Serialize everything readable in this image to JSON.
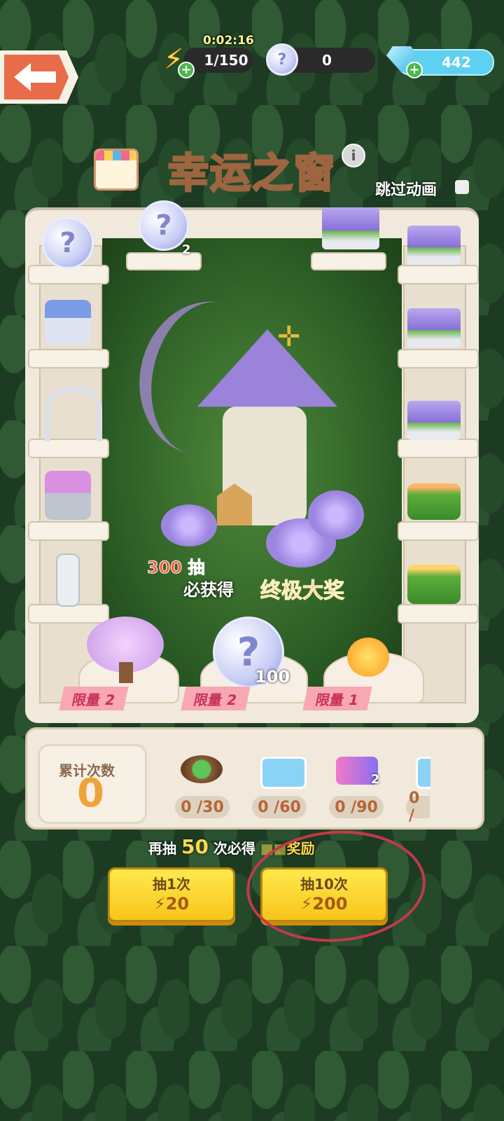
{
  "hud": {
    "timer": "0:02:16",
    "energy": "1/150",
    "coins": "0",
    "gems": "442"
  },
  "title": "幸运之窗",
  "skip_animation_label": "跳过动画",
  "prize_shelf": {
    "top_coin_count": "2",
    "pedestal_coin_count": "100",
    "limits": [
      "限量 2",
      "限量 2",
      "限量 1"
    ]
  },
  "promo": {
    "count": "300",
    "draw_unit": "抽",
    "guarantee_text": "必获得",
    "grand_prize": "终极大奖"
  },
  "progress": {
    "label": "累计次数",
    "value": "0",
    "milestones": [
      {
        "text": "0 /30"
      },
      {
        "text": "0 /60"
      },
      {
        "text": "0 /90",
        "badge": "2"
      },
      {
        "text": "0 /"
      }
    ]
  },
  "hint": {
    "prefix": "再抽",
    "number": "50",
    "middle": "次必得",
    "suffix": "奖励"
  },
  "buttons": {
    "draw_one_label": "抽1次",
    "draw_one_cost": "20",
    "draw_ten_label": "抽10次",
    "draw_ten_cost": "200"
  },
  "colors": {
    "accent_yellow": "#f8c51a",
    "limit_pink": "#f7a8b3",
    "annotation_red": "#c23a48"
  },
  "icons": [
    "back-arrow-icon",
    "energy-bolt-icon",
    "coin-icon",
    "gem-icon",
    "info-icon",
    "shop-icon"
  ]
}
